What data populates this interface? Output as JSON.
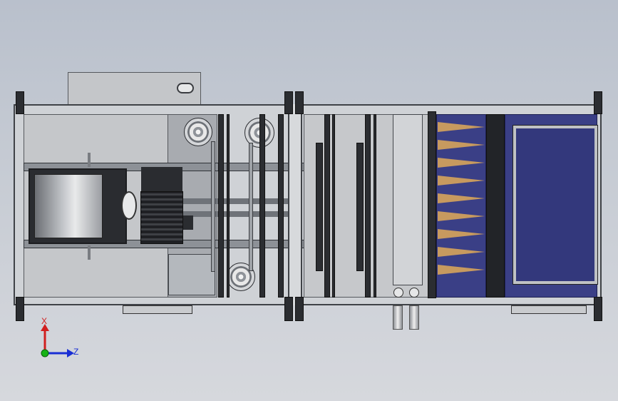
{
  "viewer": {
    "triad": {
      "x_label": "X",
      "z_label": "Z"
    },
    "colors": {
      "background_top": "#b9c0cc",
      "frame": "#cfd2d6",
      "filter_bay": "#3a3f86",
      "filter_cones": "#c79a5f",
      "x_axis": "#d11f1f",
      "z_axis": "#1a2fd4",
      "origin": "#16b316"
    },
    "model": {
      "type": "air-handling-unit-top-view",
      "sections": [
        "fan-section",
        "pulley-belt-section",
        "damper-section",
        "bag-filter-section",
        "panel-filter-section"
      ],
      "filter_cone_count": 9
    }
  }
}
